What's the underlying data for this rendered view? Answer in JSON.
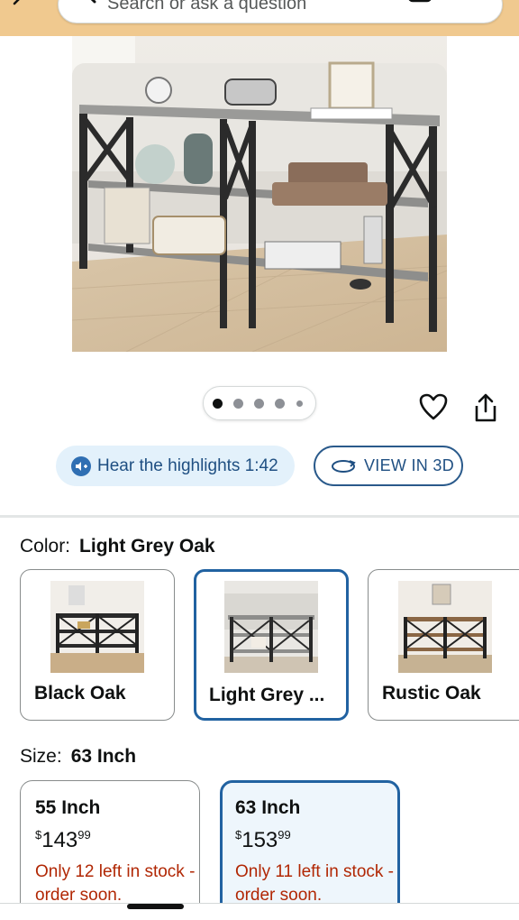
{
  "search": {
    "placeholder": "Search or ask a question"
  },
  "carousel": {
    "total": 5,
    "active": 0
  },
  "actions": {
    "hear_label": "Hear the highlights 1:42",
    "view3d_label": "VIEW IN 3D"
  },
  "color": {
    "label": "Color:",
    "selected": "Light Grey Oak",
    "options": [
      {
        "name": "Black Oak",
        "selected": false
      },
      {
        "name": "Light Grey ...",
        "selected": true
      },
      {
        "name": "Rustic Oak",
        "selected": false
      }
    ]
  },
  "size": {
    "label": "Size:",
    "selected": "63 Inch",
    "options": [
      {
        "name": "55 Inch",
        "price_dollars": "143",
        "price_cents": "99",
        "stock": "Only 12 left in stock - order soon.",
        "selected": false
      },
      {
        "name": "63 Inch",
        "price_dollars": "153",
        "price_cents": "99",
        "stock": "Only 11 left in stock - order soon.",
        "selected": true
      }
    ]
  },
  "theme": {
    "accent": "#2162a1",
    "header_bg": "#f0c98f",
    "stock_color": "#b12704"
  }
}
